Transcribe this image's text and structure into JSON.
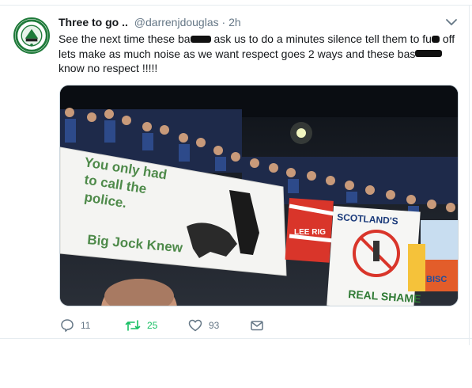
{
  "tweet": {
    "display_name": "Three to go ..",
    "handle": "@darrenjdouglas",
    "separator": "·",
    "time": "2h",
    "text": {
      "p1": "See the next time these ba",
      "p2": " ask us to do a minutes silence tell them to fu",
      "p3": "off lets make as much noise as we want respect goes 2 ways and these bas",
      "p4": "know no respect !!!!!"
    },
    "media": {
      "banner_text": [
        "You only had",
        "to call the",
        "police."
      ],
      "banner_tagline": "Big Jock Knew",
      "flag_text": "LEE RIG",
      "sign_text": "SCOTLAND'S",
      "shame_text": "REAL SHAME",
      "side_text": "BISC"
    },
    "actions": {
      "replies": "11",
      "retweets": "25",
      "likes": "93"
    }
  },
  "colors": {
    "retweet_active": "#17bf63",
    "secondary_text": "#657786",
    "avatar_ring": "#1f7a3a"
  },
  "icons": {
    "avatar": "club-crest-avatar",
    "caret": "chevron-down-icon",
    "reply": "reply-icon",
    "retweet": "retweet-icon",
    "like": "heart-icon",
    "dm": "envelope-icon"
  }
}
